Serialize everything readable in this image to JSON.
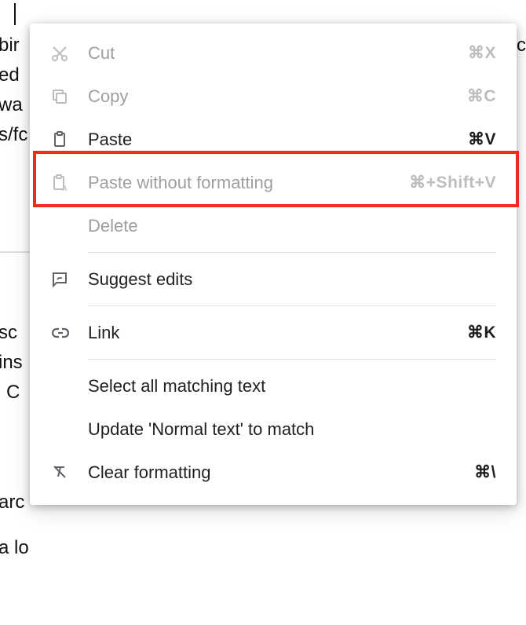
{
  "background": {
    "line1a": "bir",
    "line1b": "c",
    "line2": "ed",
    "line3": "wa",
    "line4": "s/fc",
    "line5": "sc",
    "line6": "ins",
    "line7": "C",
    "line8": "arc",
    "line9": "a lo"
  },
  "menu": {
    "cut": {
      "label": "Cut",
      "shortcut": "⌘X"
    },
    "copy": {
      "label": "Copy",
      "shortcut": "⌘C"
    },
    "paste": {
      "label": "Paste",
      "shortcut": "⌘V"
    },
    "paste_without_formatting": {
      "label": "Paste without formatting",
      "shortcut": "⌘+Shift+V"
    },
    "delete": {
      "label": "Delete"
    },
    "suggest_edits": {
      "label": "Suggest edits"
    },
    "link": {
      "label": "Link",
      "shortcut": "⌘K"
    },
    "select_all_matching": {
      "label": "Select all matching text"
    },
    "update_normal": {
      "label": "Update 'Normal text' to match"
    },
    "clear_formatting": {
      "label": "Clear formatting",
      "shortcut": "⌘\\"
    }
  }
}
